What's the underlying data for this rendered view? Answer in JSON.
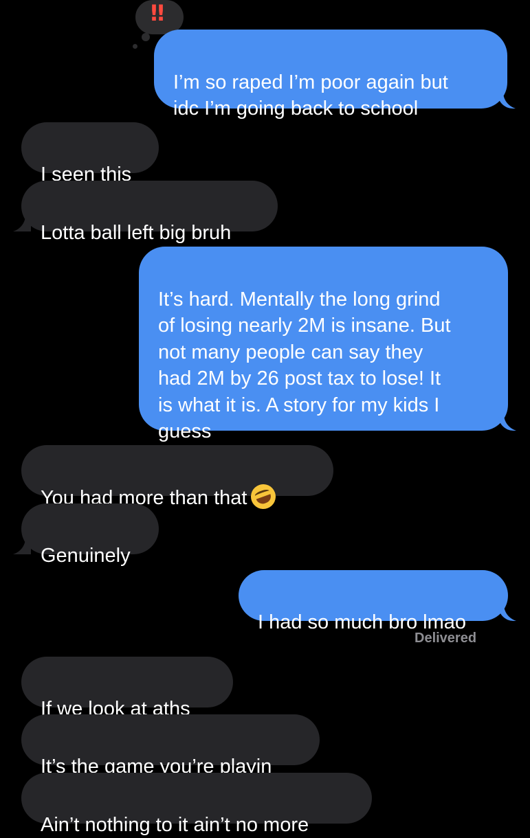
{
  "conversation": {
    "reaction": {
      "glyph": "‼",
      "icon": "double-exclamation-icon",
      "color": "#ff4a3f"
    },
    "messages": [
      {
        "side": "sent",
        "text": "I’m so raped I’m poor again but\nidc I’m going back to school"
      },
      {
        "side": "received",
        "text": "I seen this"
      },
      {
        "side": "received",
        "text": "Lotta ball left big bruh"
      },
      {
        "side": "sent",
        "text": "It’s hard. Mentally the long grind\nof losing nearly 2M is insane. But\nnot many people can say they\nhad 2M by 26 post tax to lose! It\nis what it is. A story for my kids I\nguess"
      },
      {
        "side": "received",
        "text": "You had more than that",
        "emoji": "rolling-on-floor-laughing-emoji"
      },
      {
        "side": "received",
        "text": "Genuinely"
      },
      {
        "side": "sent",
        "text": "I had so much bro lmao"
      },
      {
        "side": "received",
        "text": "If we look at aths"
      },
      {
        "side": "received",
        "text": "It’s the game you’re playin"
      },
      {
        "side": "received",
        "text": "Ain’t nothing to it ain’t no more"
      }
    ],
    "delivered_label": "Delivered"
  },
  "colors": {
    "background": "#000000",
    "sent_bubble": "#4a8ff2",
    "received_bubble": "#262629",
    "delivered_text": "#8e8e93"
  }
}
